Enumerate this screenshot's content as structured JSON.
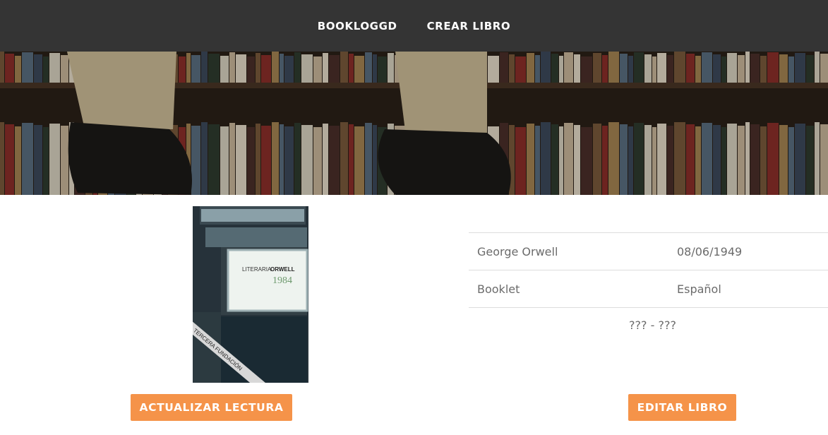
{
  "nav": {
    "items": [
      {
        "label": "BOOKLOGGD"
      },
      {
        "label": "CREAR LIBRO"
      }
    ]
  },
  "book": {
    "cover": {
      "publisher_text": "LITERARIA",
      "author_text": "ORWELL",
      "title_text": "1984",
      "band_text": "TERCERA FUNDACIÓN"
    },
    "author": "George Orwell",
    "date": "08/06/1949",
    "format": "Booklet",
    "language": "Español",
    "reading_range": "??? - ???"
  },
  "actions": {
    "update_label": "ACTUALIZAR LECTURA",
    "edit_label": "EDITAR LIBRO"
  },
  "colors": {
    "navbar": "#343434",
    "accent": "#f59349",
    "text": "#6b6b6b"
  }
}
